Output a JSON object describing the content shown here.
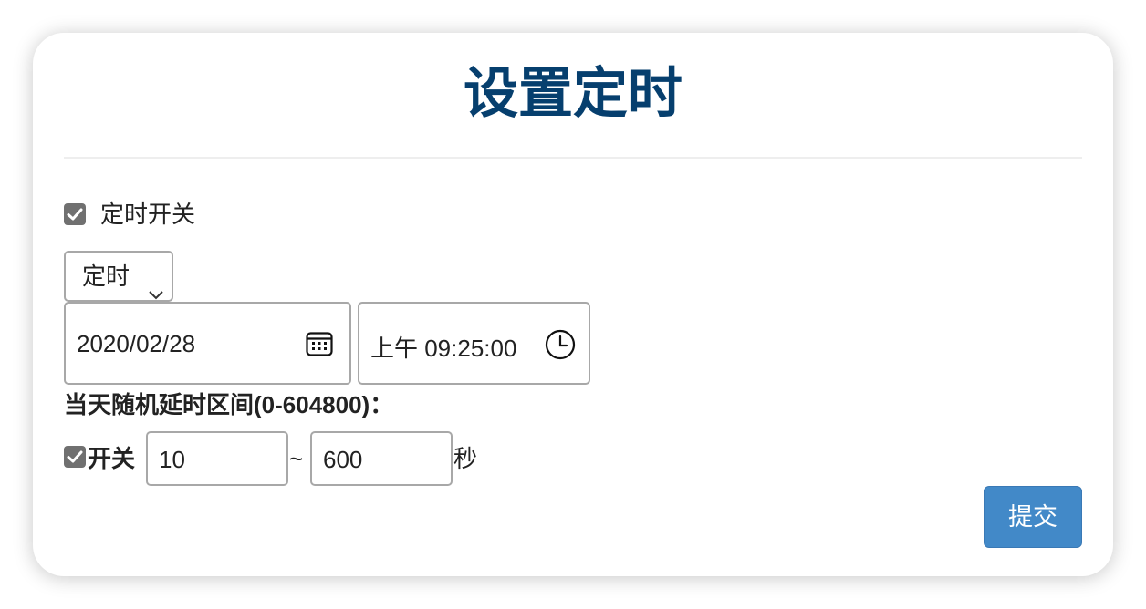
{
  "dialog": {
    "title": "设置定时",
    "timer_switch": {
      "label": "定时开关",
      "checked": true
    },
    "mode_select": {
      "selected": "定时"
    },
    "date_input": {
      "value": "2020/02/28",
      "icon": "calendar-icon"
    },
    "time_input": {
      "value": "上午 09:25:00",
      "icon": "clock-icon"
    },
    "random_delay": {
      "heading": "当天随机延时区间(0-604800)：",
      "switch_label": "开关",
      "checked": true,
      "min_value": "10",
      "separator": "~",
      "max_value": "600",
      "unit": "秒"
    },
    "submit_label": "提交"
  },
  "colors": {
    "title": "#063f6e",
    "checkbox": "#707070",
    "button": "#4289c8",
    "border": "#a8a8a8"
  }
}
